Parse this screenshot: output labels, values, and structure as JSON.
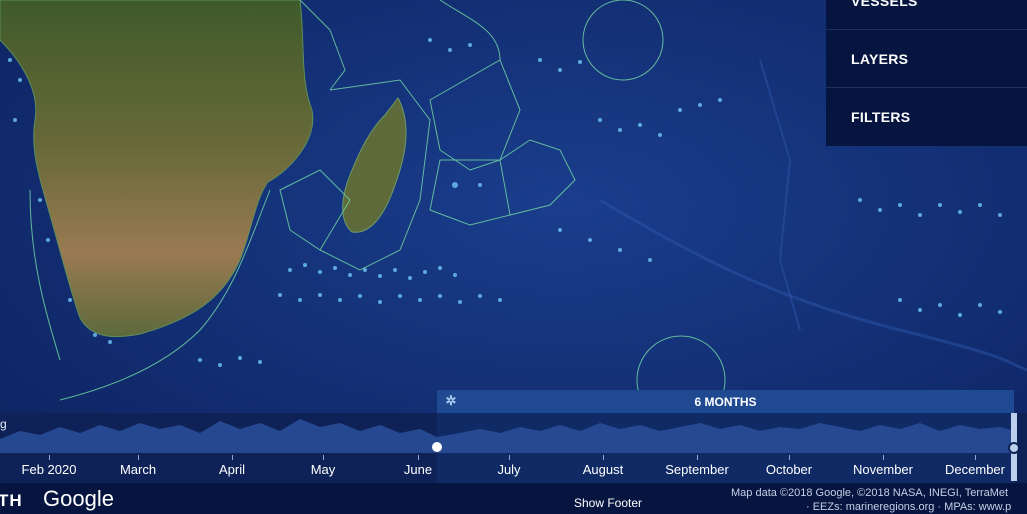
{
  "menu": {
    "items": [
      {
        "label": "VESSELS"
      },
      {
        "label": "LAYERS"
      },
      {
        "label": "FILTERS"
      }
    ]
  },
  "timebar": {
    "range_label": "6 MONTHS",
    "left_label": "g",
    "months": [
      "Feb 2020",
      "March",
      "April",
      "May",
      "June",
      "July",
      "August",
      "September",
      "October",
      "November",
      "December"
    ],
    "colors": {
      "range": "#1f4a92",
      "histogram": "#2a4f9a"
    }
  },
  "footer": {
    "brand_fragment": "TH",
    "google": "Google",
    "show_footer": "Show Footer",
    "attribution_line1": "Map data ©2018 Google, ©2018 NASA, INEGI, TerraMet",
    "attribution_line2": "· EEZs: marineregions.org · MPAs: www.p"
  },
  "icons": {
    "settings": "gear-icon"
  }
}
